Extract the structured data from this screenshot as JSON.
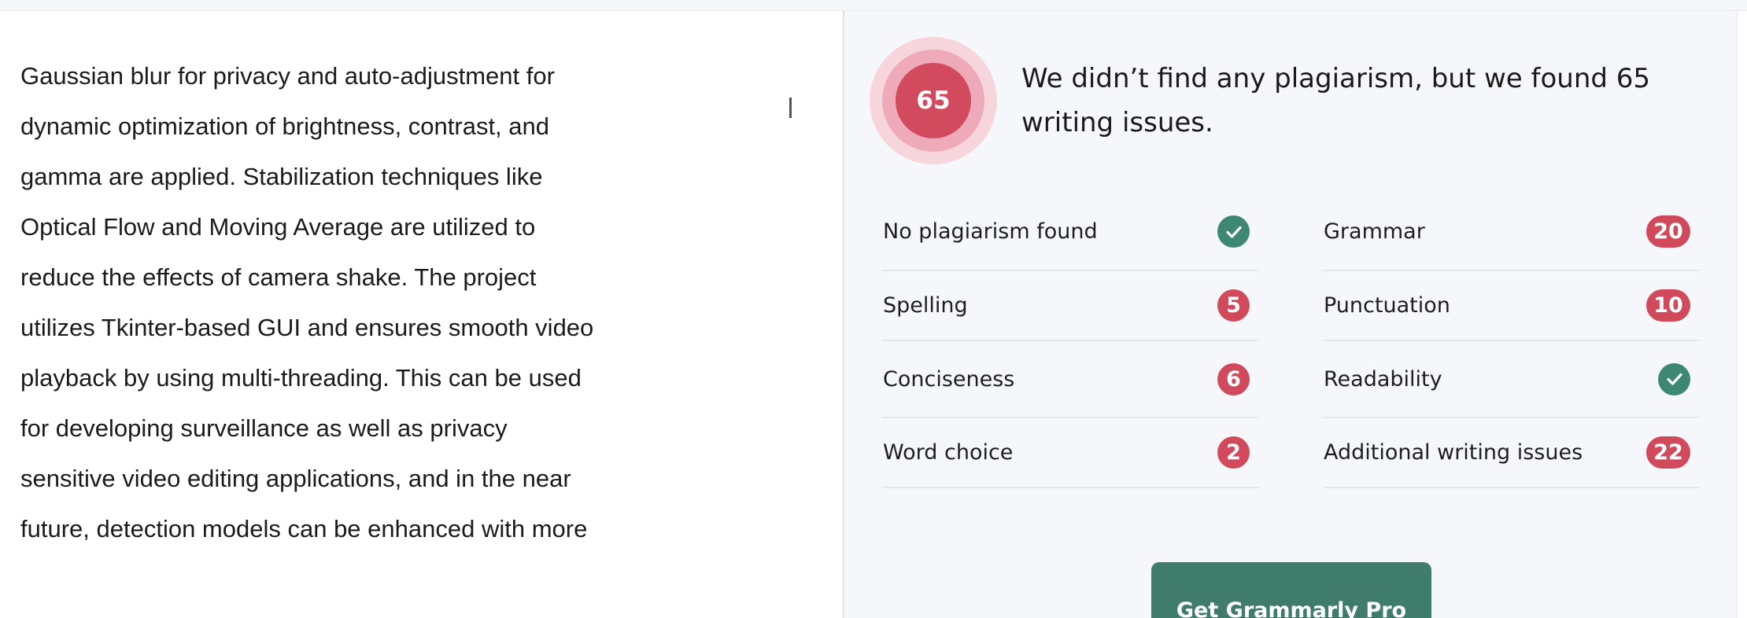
{
  "document": {
    "lines": [
      "Gaussian blur for privacy and auto-adjustment for",
      "dynamic optimization of brightness, contrast, and",
      "gamma are applied. Stabilization techniques like",
      "Optical Flow and Moving Average are utilized to",
      "reduce the effects of camera shake. The project",
      "utilizes Tkinter-based GUI and ensures smooth video",
      "playback by using multi-threading. This can be used",
      "for developing surveillance as well as privacy",
      "sensitive video editing applications, and in the near",
      "future, detection models can be enhanced with more"
    ]
  },
  "report": {
    "score": "65",
    "headline": "We didn’t find any plagiarism, but we found 65 writing issues.",
    "left_items": [
      {
        "label": "No plagiarism found",
        "status": "check"
      },
      {
        "label": "Spelling",
        "count": "5"
      },
      {
        "label": "Conciseness",
        "count": "6"
      },
      {
        "label": "Word choice",
        "count": "2"
      }
    ],
    "right_items": [
      {
        "label": "Grammar",
        "count": "20"
      },
      {
        "label": "Punctuation",
        "count": "10"
      },
      {
        "label": "Readability",
        "status": "check"
      },
      {
        "label": "Additional writing issues",
        "count": "22"
      }
    ],
    "cta_label": "Get Grammarly Pro"
  },
  "colors": {
    "issue_badge": "#d14a5c",
    "check_badge": "#3f8775",
    "cta_button": "#3f7c6c",
    "panel_bg": "#f6f7fb"
  },
  "icons": {
    "check": "checkmark-icon"
  }
}
